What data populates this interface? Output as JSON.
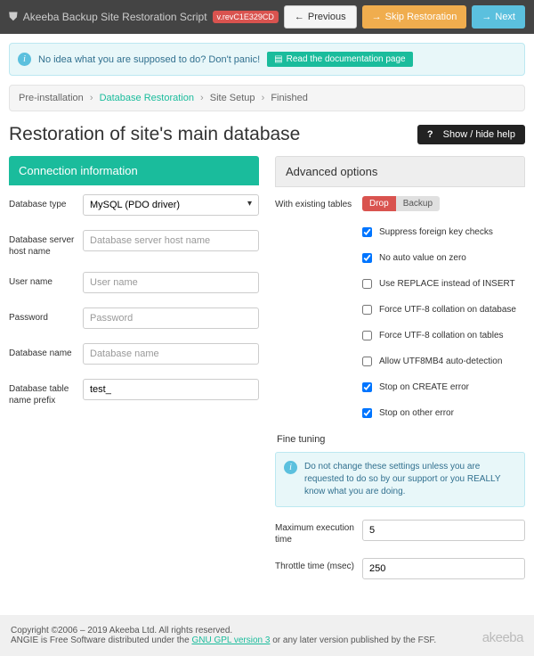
{
  "navbar": {
    "title": "Akeeba Backup Site Restoration Script",
    "version": "v.revC1E329CD",
    "prev": "Previous",
    "skip": "Skip Restoration",
    "next": "Next"
  },
  "tip": {
    "text": "No idea what you are supposed to do? Don't panic!",
    "btn": "Read the documentation page"
  },
  "crumbs": {
    "a": "Pre-installation",
    "b": "Database Restoration",
    "c": "Site Setup",
    "d": "Finished"
  },
  "page_title": "Restoration of site's main database",
  "help_btn": "Show / hide help",
  "conn": {
    "title": "Connection information",
    "db_type_label": "Database type",
    "db_type_value": "MySQL (PDO driver)",
    "host_label": "Database server host name",
    "host_ph": "Database server host name",
    "user_label": "User name",
    "user_ph": "User name",
    "pass_label": "Password",
    "pass_ph": "Password",
    "dbname_label": "Database name",
    "dbname_ph": "Database name",
    "prefix_label": "Database table name prefix",
    "prefix_val": "test_"
  },
  "adv": {
    "title": "Advanced options",
    "existing_label": "With existing tables",
    "drop": "Drop",
    "backup": "Backup",
    "checks": [
      {
        "label": "Suppress foreign key checks",
        "checked": true
      },
      {
        "label": "No auto value on zero",
        "checked": true
      },
      {
        "label": "Use REPLACE instead of INSERT",
        "checked": false
      },
      {
        "label": "Force UTF-8 collation on database",
        "checked": false
      },
      {
        "label": "Force UTF-8 collation on tables",
        "checked": false
      },
      {
        "label": "Allow UTF8MB4 auto-detection",
        "checked": false
      },
      {
        "label": "Stop on CREATE error",
        "checked": true
      },
      {
        "label": "Stop on other error",
        "checked": true
      }
    ],
    "fine_title": "Fine tuning",
    "fine_warn": "Do not change these settings unless you are requested to do so by our support or you REALLY know what you are doing.",
    "max_exec_label": "Maximum execution time",
    "max_exec_val": "5",
    "throttle_label": "Throttle time (msec)",
    "throttle_val": "250"
  },
  "footer": {
    "copy": "Copyright ©2006 – 2019 Akeeba Ltd. All rights reserved.",
    "line2a": "ANGIE is Free Software distributed under the ",
    "link": "GNU GPL version 3",
    "line2b": " or any later version published by the FSF.",
    "logo": "akeeba"
  }
}
